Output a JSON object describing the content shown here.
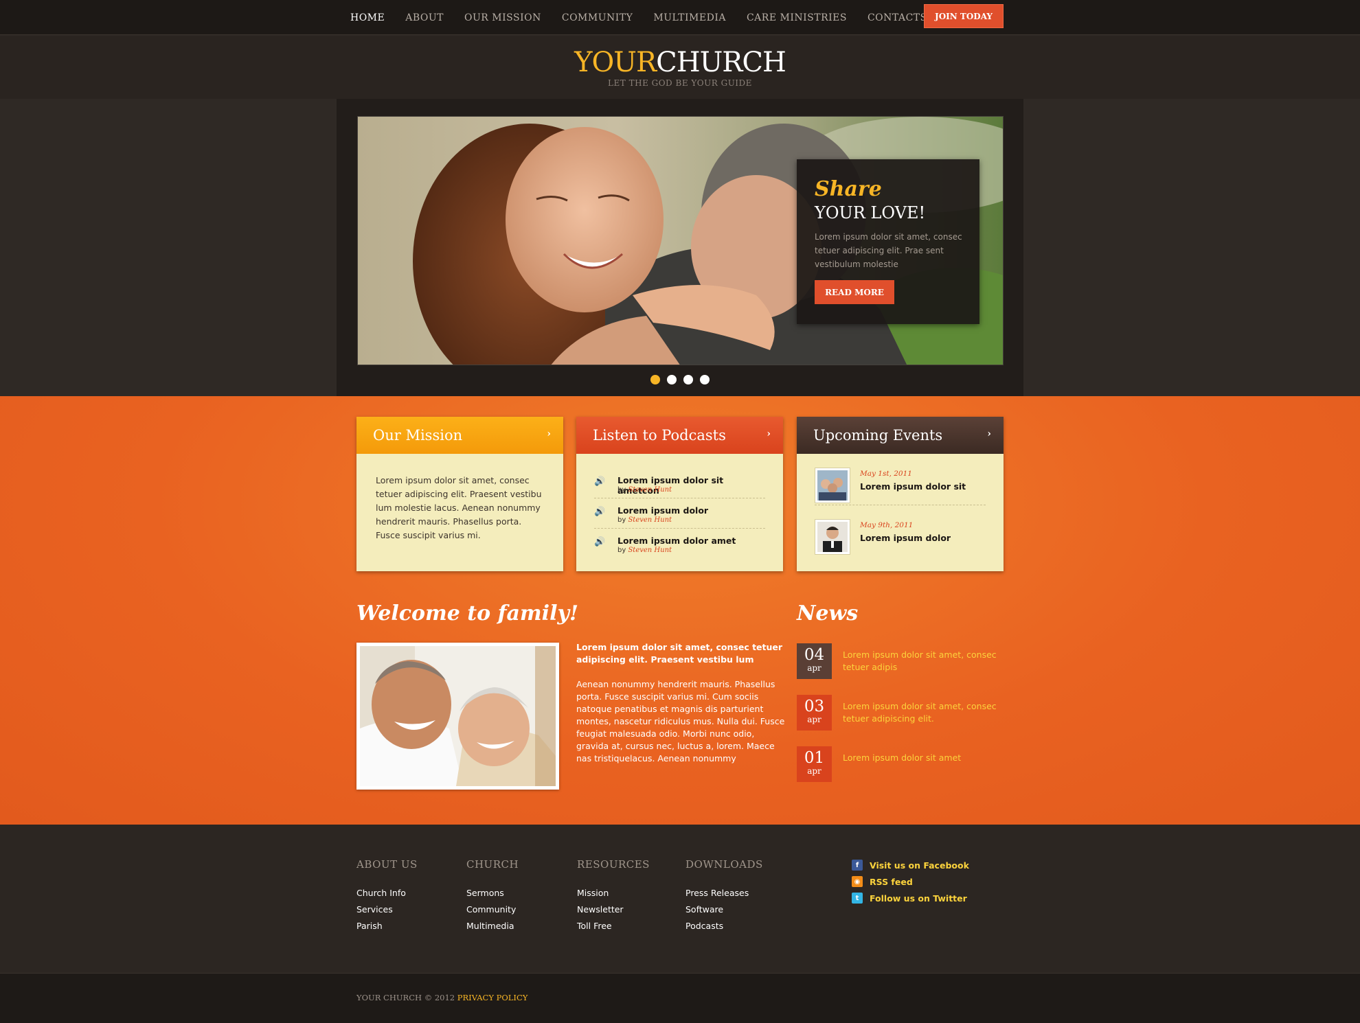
{
  "nav": {
    "items": [
      "HOME",
      "ABOUT",
      "OUR MISSION",
      "COMMUNITY",
      "MULTIMEDIA",
      "CARE MINISTRIES",
      "CONTACTS"
    ],
    "join": "JOIN TODAY"
  },
  "logo": {
    "your": "YOUR",
    "church": "CHURCH",
    "tagline": "LET THE GOD BE YOUR GUIDE"
  },
  "slider": {
    "title1": "Share",
    "title2": "YOUR LOVE!",
    "text": "Lorem ipsum dolor sit amet, consec tetuer adipiscing elit. Prae sent vestibulum molestie",
    "button": "READ MORE",
    "active_dot": 1,
    "dot_count": 4
  },
  "mission": {
    "title": "Our Mission",
    "arrow": "›",
    "text": "Lorem ipsum dolor sit amet, consec tetuer adipiscing elit. Praesent vestibu lum molestie lacus. Aenean nonummy hendrerit mauris. Phasellus porta. Fusce suscipit varius mi."
  },
  "podcasts": {
    "title": "Listen to Podcasts",
    "arrow": "›",
    "items": [
      {
        "title": "Lorem ipsum dolor sit ametcon",
        "by": "by",
        "author": "Steven Hunt"
      },
      {
        "title": "Lorem ipsum dolor",
        "by": "by",
        "author": "Steven Hunt"
      },
      {
        "title": "Lorem ipsum dolor amet",
        "by": "by",
        "author": "Steven Hunt"
      }
    ]
  },
  "events": {
    "title": "Upcoming Events",
    "arrow": "›",
    "items": [
      {
        "date": "May 1st, 2011",
        "title": "Lorem ipsum dolor sit"
      },
      {
        "date": "May 9th, 2011",
        "title": "Lorem ipsum dolor"
      }
    ]
  },
  "welcome": {
    "title": "Welcome to family!",
    "lead": "Lorem ipsum dolor sit amet, consec tetuer adipiscing elit. Praesent vestibu lum",
    "body": "Aenean nonummy  hendrerit mauris. Phasellus porta. Fusce suscipit varius mi. Cum sociis natoque penatibus et magnis dis parturient montes, nascetur ridiculus mus. Nulla dui. Fusce feugiat malesuada odio. Morbi nunc odio, gravida at, cursus nec, luctus a, lorem. Maece nas tristiquelacus. Aenean nonummy"
  },
  "news": {
    "title": "News",
    "items": [
      {
        "day": "04",
        "month": "apr",
        "text": "Lorem ipsum dolor sit amet, consec tetuer adipis",
        "color": "#5a3f35"
      },
      {
        "day": "03",
        "month": "apr",
        "text": "Lorem ipsum dolor sit amet, consec tetuer adipiscing elit.",
        "color": "#d9431d"
      },
      {
        "day": "01",
        "month": "apr",
        "text": "Lorem ipsum dolor sit amet",
        "color": "#d9431d"
      }
    ]
  },
  "footer": {
    "columns": [
      {
        "heading": "ABOUT US",
        "links": [
          "Church  Info",
          "Services",
          "Parish"
        ]
      },
      {
        "heading": "CHURCH",
        "links": [
          "Sermons",
          "Community",
          "Multimedia"
        ]
      },
      {
        "heading": "RESOURCES",
        "links": [
          "Mission",
          "Newsletter",
          "Toll Free"
        ]
      },
      {
        "heading": "DOWNLOADS",
        "links": [
          "Press Releases",
          "Software",
          "Podcasts"
        ]
      }
    ],
    "social": [
      {
        "icon": "facebook-icon",
        "label": "Visit us on Facebook",
        "glyph": "f",
        "color": "#3b5998"
      },
      {
        "icon": "rss-icon",
        "label": "RSS feed",
        "glyph": "◉",
        "color": "#f28c18"
      },
      {
        "icon": "twitter-icon",
        "label": "Follow us on Twitter",
        "glyph": "t",
        "color": "#33b5e5"
      }
    ],
    "copyright": "YOUR CHURCH © 2012",
    "privacy": "PRIVACY POLICY"
  }
}
